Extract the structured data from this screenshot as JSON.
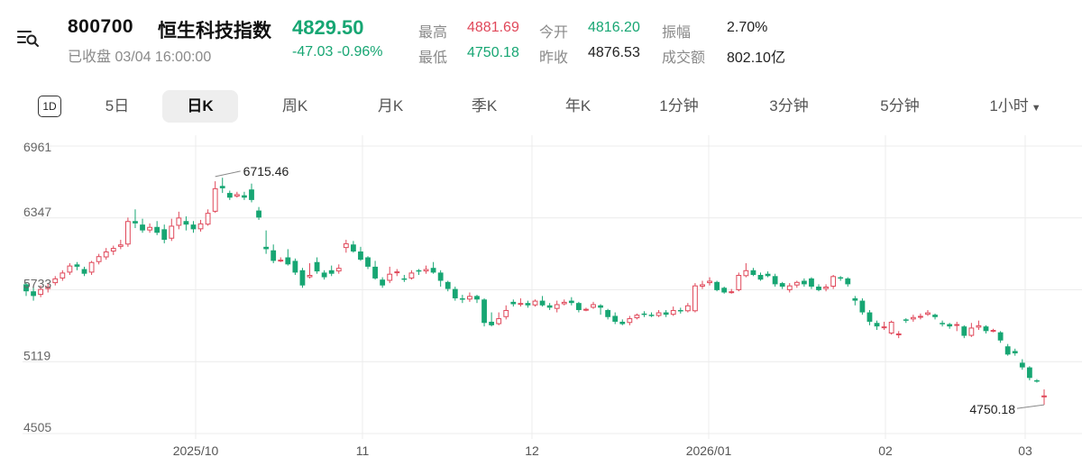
{
  "header": {
    "code": "800700",
    "name": "恒生科技指数",
    "price": "4829.50",
    "status": "已收盘 03/04 16:00:00",
    "change": "-47.03 -0.96%",
    "stats": {
      "high_label": "最高",
      "high": "4881.69",
      "open_label": "今开",
      "open": "4816.20",
      "amp_label": "振幅",
      "amp": "2.70%",
      "low_label": "最低",
      "low": "4750.18",
      "prev_label": "昨收",
      "prev": "4876.53",
      "turnover_label": "成交额",
      "turnover": "802.10亿"
    }
  },
  "tabs": [
    "1D",
    "5日",
    "日K",
    "周K",
    "月K",
    "季K",
    "年K",
    "1分钟",
    "3分钟",
    "5分钟",
    "1小时"
  ],
  "active_tab": "日K",
  "colors": {
    "up": "#e0485a",
    "down": "#17a673",
    "text_gray": "#8a8a8a"
  },
  "icons": {
    "menu": "list-search-icon",
    "dropdown": "caret-down-icon"
  },
  "chart_data": {
    "type": "candlestick",
    "y_ticks": [
      "6961",
      "6347",
      "5733",
      "5119",
      "4505"
    ],
    "y_tick_values": [
      6961,
      6347,
      5733,
      5119,
      4505
    ],
    "ylim": [
      4505,
      6961
    ],
    "x_ticks": [
      "2025/10",
      "11",
      "12",
      "2026/01",
      "02",
      "03"
    ],
    "annotations": [
      {
        "label": "6715.46",
        "value": 6715.46,
        "note": "high"
      },
      {
        "label": "4750.18",
        "value": 4750.18,
        "note": "low"
      }
    ],
    "candles": [
      [
        5780,
        5720,
        5800,
        5680
      ],
      [
        5720,
        5680,
        5760,
        5640
      ],
      [
        5690,
        5740,
        5770,
        5670
      ],
      [
        5740,
        5760,
        5790,
        5710
      ],
      [
        5790,
        5830,
        5850,
        5770
      ],
      [
        5830,
        5880,
        5900,
        5810
      ],
      [
        5880,
        5940,
        5960,
        5860
      ],
      [
        5950,
        5930,
        5970,
        5900
      ],
      [
        5910,
        5870,
        5930,
        5850
      ],
      [
        5880,
        5970,
        5980,
        5860
      ],
      [
        5970,
        6020,
        6040,
        5950
      ],
      [
        6010,
        6060,
        6090,
        5990
      ],
      [
        6060,
        6090,
        6110,
        6030
      ],
      [
        6100,
        6120,
        6160,
        6080
      ],
      [
        6120,
        6320,
        6350,
        6100
      ],
      [
        6320,
        6300,
        6420,
        6260
      ],
      [
        6290,
        6240,
        6340,
        6220
      ],
      [
        6240,
        6270,
        6300,
        6220
      ],
      [
        6270,
        6220,
        6320,
        6200
      ],
      [
        6250,
        6160,
        6290,
        6130
      ],
      [
        6170,
        6280,
        6340,
        6150
      ],
      [
        6280,
        6350,
        6400,
        6250
      ],
      [
        6320,
        6290,
        6360,
        6240
      ],
      [
        6290,
        6250,
        6320,
        6220
      ],
      [
        6250,
        6300,
        6330,
        6230
      ],
      [
        6290,
        6390,
        6420,
        6280
      ],
      [
        6400,
        6600,
        6660,
        6390
      ],
      [
        6620,
        6600,
        6690,
        6560
      ],
      [
        6560,
        6520,
        6580,
        6500
      ],
      [
        6530,
        6550,
        6570,
        6520
      ],
      [
        6540,
        6520,
        6570,
        6500
      ],
      [
        6590,
        6500,
        6640,
        6480
      ],
      [
        6410,
        6350,
        6440,
        6330
      ],
      [
        6100,
        6080,
        6240,
        6040
      ],
      [
        6070,
        5980,
        6120,
        5960
      ],
      [
        5990,
        5990,
        6010,
        5970
      ],
      [
        6010,
        5950,
        6080,
        5940
      ],
      [
        5980,
        5880,
        6000,
        5860
      ],
      [
        5900,
        5770,
        5920,
        5750
      ],
      [
        5840,
        5860,
        5960,
        5830
      ],
      [
        5970,
        5890,
        6010,
        5870
      ],
      [
        5880,
        5840,
        5900,
        5820
      ],
      [
        5900,
        5870,
        5940,
        5850
      ],
      [
        5890,
        5920,
        5950,
        5870
      ],
      [
        6090,
        6130,
        6160,
        6050
      ],
      [
        6120,
        6060,
        6150,
        6050
      ],
      [
        6060,
        5990,
        6100,
        5980
      ],
      [
        6010,
        5930,
        6020,
        5910
      ],
      [
        5930,
        5830,
        5980,
        5820
      ],
      [
        5820,
        5770,
        5840,
        5750
      ],
      [
        5810,
        5870,
        5930,
        5790
      ],
      [
        5880,
        5890,
        5910,
        5850
      ],
      [
        5830,
        5820,
        5860,
        5800
      ],
      [
        5830,
        5880,
        5900,
        5820
      ],
      [
        5900,
        5890,
        5910,
        5860
      ],
      [
        5890,
        5910,
        5940,
        5870
      ],
      [
        5920,
        5880,
        5970,
        5870
      ],
      [
        5880,
        5810,
        5900,
        5760
      ],
      [
        5800,
        5740,
        5810,
        5720
      ],
      [
        5740,
        5660,
        5760,
        5640
      ],
      [
        5660,
        5650,
        5690,
        5620
      ],
      [
        5650,
        5680,
        5710,
        5630
      ],
      [
        5680,
        5650,
        5690,
        5620
      ],
      [
        5650,
        5450,
        5660,
        5420
      ],
      [
        5460,
        5430,
        5540,
        5420
      ],
      [
        5440,
        5490,
        5540,
        5430
      ],
      [
        5500,
        5560,
        5600,
        5480
      ],
      [
        5630,
        5610,
        5650,
        5590
      ],
      [
        5610,
        5620,
        5660,
        5590
      ],
      [
        5620,
        5600,
        5640,
        5580
      ],
      [
        5600,
        5640,
        5650,
        5590
      ],
      [
        5640,
        5600,
        5680,
        5590
      ],
      [
        5600,
        5580,
        5620,
        5560
      ],
      [
        5570,
        5610,
        5640,
        5540
      ],
      [
        5610,
        5630,
        5650,
        5600
      ],
      [
        5640,
        5620,
        5670,
        5600
      ],
      [
        5620,
        5560,
        5630,
        5540
      ],
      [
        5560,
        5570,
        5580,
        5550
      ],
      [
        5580,
        5610,
        5630,
        5570
      ],
      [
        5600,
        5580,
        5610,
        5520
      ],
      [
        5560,
        5500,
        5570,
        5480
      ],
      [
        5510,
        5460,
        5540,
        5440
      ],
      [
        5460,
        5440,
        5480,
        5430
      ],
      [
        5450,
        5490,
        5510,
        5430
      ],
      [
        5490,
        5520,
        5530,
        5480
      ],
      [
        5530,
        5520,
        5550,
        5500
      ],
      [
        5520,
        5510,
        5540,
        5500
      ],
      [
        5510,
        5540,
        5560,
        5500
      ],
      [
        5540,
        5520,
        5560,
        5500
      ],
      [
        5520,
        5560,
        5590,
        5510
      ],
      [
        5560,
        5550,
        5580,
        5530
      ],
      [
        5550,
        5600,
        5620,
        5540
      ],
      [
        5550,
        5770,
        5790,
        5540
      ],
      [
        5760,
        5780,
        5810,
        5740
      ],
      [
        5790,
        5810,
        5840,
        5770
      ],
      [
        5800,
        5730,
        5810,
        5720
      ],
      [
        5750,
        5710,
        5760,
        5700
      ],
      [
        5710,
        5720,
        5740,
        5700
      ],
      [
        5730,
        5860,
        5880,
        5720
      ],
      [
        5850,
        5900,
        5960,
        5840
      ],
      [
        5900,
        5860,
        5920,
        5850
      ],
      [
        5860,
        5820,
        5880,
        5810
      ],
      [
        5870,
        5850,
        5890,
        5840
      ],
      [
        5850,
        5780,
        5870,
        5760
      ],
      [
        5790,
        5760,
        5800,
        5740
      ],
      [
        5730,
        5770,
        5790,
        5710
      ],
      [
        5770,
        5800,
        5810,
        5750
      ],
      [
        5810,
        5780,
        5830,
        5760
      ],
      [
        5830,
        5760,
        5840,
        5740
      ],
      [
        5760,
        5730,
        5780,
        5720
      ],
      [
        5740,
        5760,
        5780,
        5720
      ],
      [
        5760,
        5850,
        5860,
        5740
      ],
      [
        5840,
        5830,
        5850,
        5810
      ],
      [
        5830,
        5780,
        5840,
        5760
      ],
      [
        5660,
        5640,
        5680,
        5600
      ],
      [
        5640,
        5540,
        5660,
        5520
      ],
      [
        5540,
        5460,
        5560,
        5430
      ],
      [
        5450,
        5420,
        5470,
        5390
      ],
      [
        5420,
        5420,
        5460,
        5390
      ],
      [
        5360,
        5460,
        5470,
        5350
      ],
      [
        5350,
        5360,
        5380,
        5320
      ],
      [
        5480,
        5470,
        5490,
        5450
      ],
      [
        5480,
        5500,
        5520,
        5460
      ],
      [
        5500,
        5510,
        5530,
        5480
      ],
      [
        5520,
        5540,
        5560,
        5510
      ],
      [
        5520,
        5500,
        5530,
        5480
      ],
      [
        5450,
        5440,
        5470,
        5420
      ],
      [
        5440,
        5420,
        5450,
        5400
      ],
      [
        5430,
        5440,
        5460,
        5380
      ],
      [
        5420,
        5340,
        5430,
        5320
      ],
      [
        5340,
        5410,
        5450,
        5330
      ],
      [
        5410,
        5430,
        5470,
        5390
      ],
      [
        5420,
        5380,
        5430,
        5360
      ],
      [
        5380,
        5390,
        5400,
        5370
      ],
      [
        5370,
        5300,
        5380,
        5280
      ],
      [
        5250,
        5180,
        5270,
        5170
      ],
      [
        5210,
        5190,
        5230,
        5170
      ],
      [
        5110,
        5070,
        5140,
        5050
      ],
      [
        5070,
        4980,
        5080,
        4960
      ],
      [
        4960,
        4950,
        4970,
        4940
      ],
      [
        4830,
        4830,
        4882,
        4750
      ]
    ]
  }
}
